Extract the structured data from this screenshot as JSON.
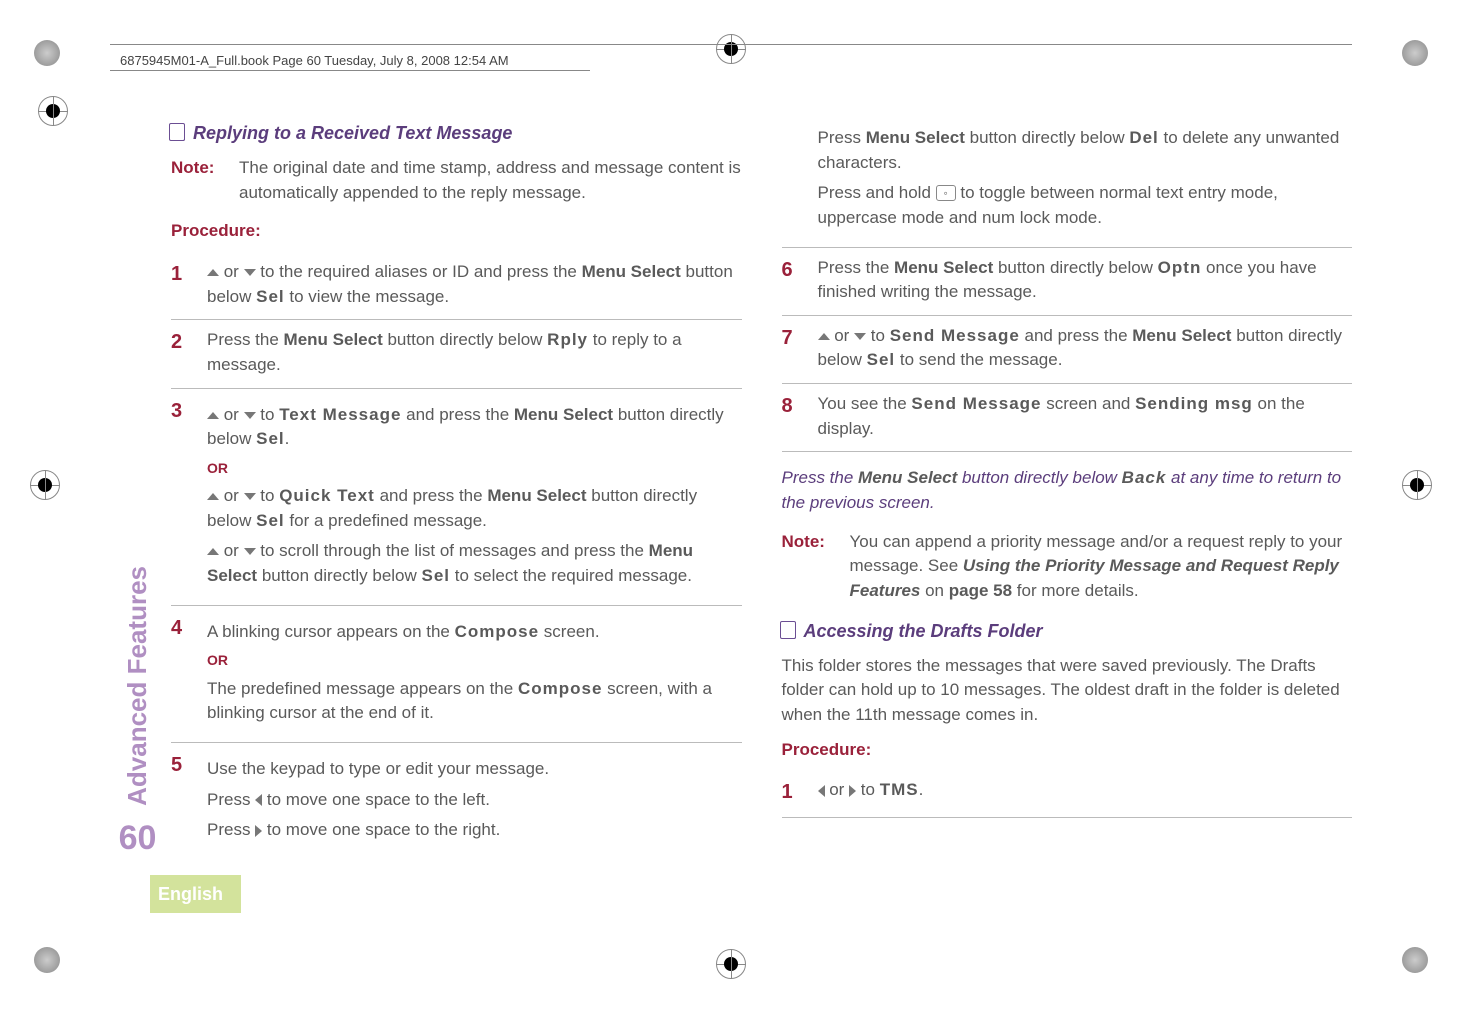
{
  "header_path": "6875945M01-A_Full.book  Page 60  Tuesday, July 8, 2008  12:54 AM",
  "side": {
    "label": "Advanced Features",
    "page": "60"
  },
  "footer_lang": "English",
  "left": {
    "sec1_title": "Replying to a Received Text Message",
    "note_label": "Note:",
    "note_text": "The original date and time stamp, address and message content is automatically appended to the reply message.",
    "procedure_label": "Procedure:",
    "s1": {
      "n": "1",
      "pre": " or ",
      "post": " to the required aliases or ID and press the ",
      "ms": "Menu Select",
      "mid": " button below ",
      "sel": "Sel",
      "end": " to view the message."
    },
    "s2": {
      "n": "2",
      "a": "Press the ",
      "ms": "Menu Select",
      "b": " button directly below ",
      "rply": "Rply",
      "c": " to reply to a message."
    },
    "s3": {
      "n": "3",
      "l1a": " or ",
      "l1b": " to ",
      "tm": "Text Message",
      "l1c": " and press the ",
      "ms": "Menu Select",
      "l1d": " button directly below ",
      "sel": "Sel",
      "l1e": ".",
      "or": "OR",
      "l2a": " or ",
      "l2b": " to ",
      "qt": "Quick Text",
      "l2c": " and press the ",
      "ms2": "Menu Select",
      "l2d": " button directly below ",
      "sel2": "Sel",
      "l2e": " for a predefined message.",
      "l3a": " or ",
      "l3b": " to scroll through the list of messages and press the ",
      "ms3": "Menu Select",
      "l3c": " button directly below ",
      "sel3": "Sel",
      "l3d": " to select the required message."
    },
    "s4": {
      "n": "4",
      "a": "A blinking cursor appears on the ",
      "comp": "Compose",
      "b": " screen.",
      "or": "OR",
      "c": "The predefined message appears on the ",
      "comp2": "Compose",
      "d": " screen, with a blinking cursor at the end of it."
    },
    "s5": {
      "n": "5",
      "a": "Use the keypad to type or edit your message.",
      "b1": "Press ",
      "b2": " to move one space to the left.",
      "c1": "Press ",
      "c2": " to move one space to the right."
    }
  },
  "right": {
    "cont5": {
      "a": "Press ",
      "ms": "Menu Select",
      "b": " button directly below ",
      "del": "Del",
      "c": " to delete any unwanted characters.",
      "d1": "Press and hold ",
      "d2": " to toggle between normal text entry mode, uppercase mode and num lock mode."
    },
    "s6": {
      "n": "6",
      "a": "Press the ",
      "ms": "Menu Select",
      "b": " button directly below ",
      "optn": "Optn",
      "c": " once you have finished writing the message."
    },
    "s7": {
      "n": "7",
      "a": " or ",
      "b": " to ",
      "send": "Send Message",
      "c": " and press the ",
      "ms": "Menu Select",
      "d": " button directly below ",
      "sel": "Sel",
      "e": " to send the message."
    },
    "s8": {
      "n": "8",
      "a": "You see the ",
      "send": "Send Message",
      "b": " screen and ",
      "sm": "Sending msg",
      "c": " on the display."
    },
    "after": {
      "a": "Press the ",
      "ms": "Menu Select",
      "b": " button directly below ",
      "back": "Back",
      "c": " at any time to return to the previous screen."
    },
    "note_label": "Note:",
    "note_a": "You can append a priority message and/or a request reply to your message. See ",
    "note_link": "Using the Priority Message and Request Reply Features",
    "note_b": " on ",
    "note_pg": "page 58",
    "note_c": " for more details.",
    "sec2_title": "Accessing the Drafts Folder",
    "sec2_para": "This folder stores the messages that were saved previously. The Drafts folder can hold up to 10 messages. The oldest draft in the folder is deleted when the 11th message comes in.",
    "procedure_label": "Procedure:",
    "d1": {
      "n": "1",
      "a": " or ",
      "b": " to ",
      "tms": "TMS",
      "c": "."
    }
  }
}
